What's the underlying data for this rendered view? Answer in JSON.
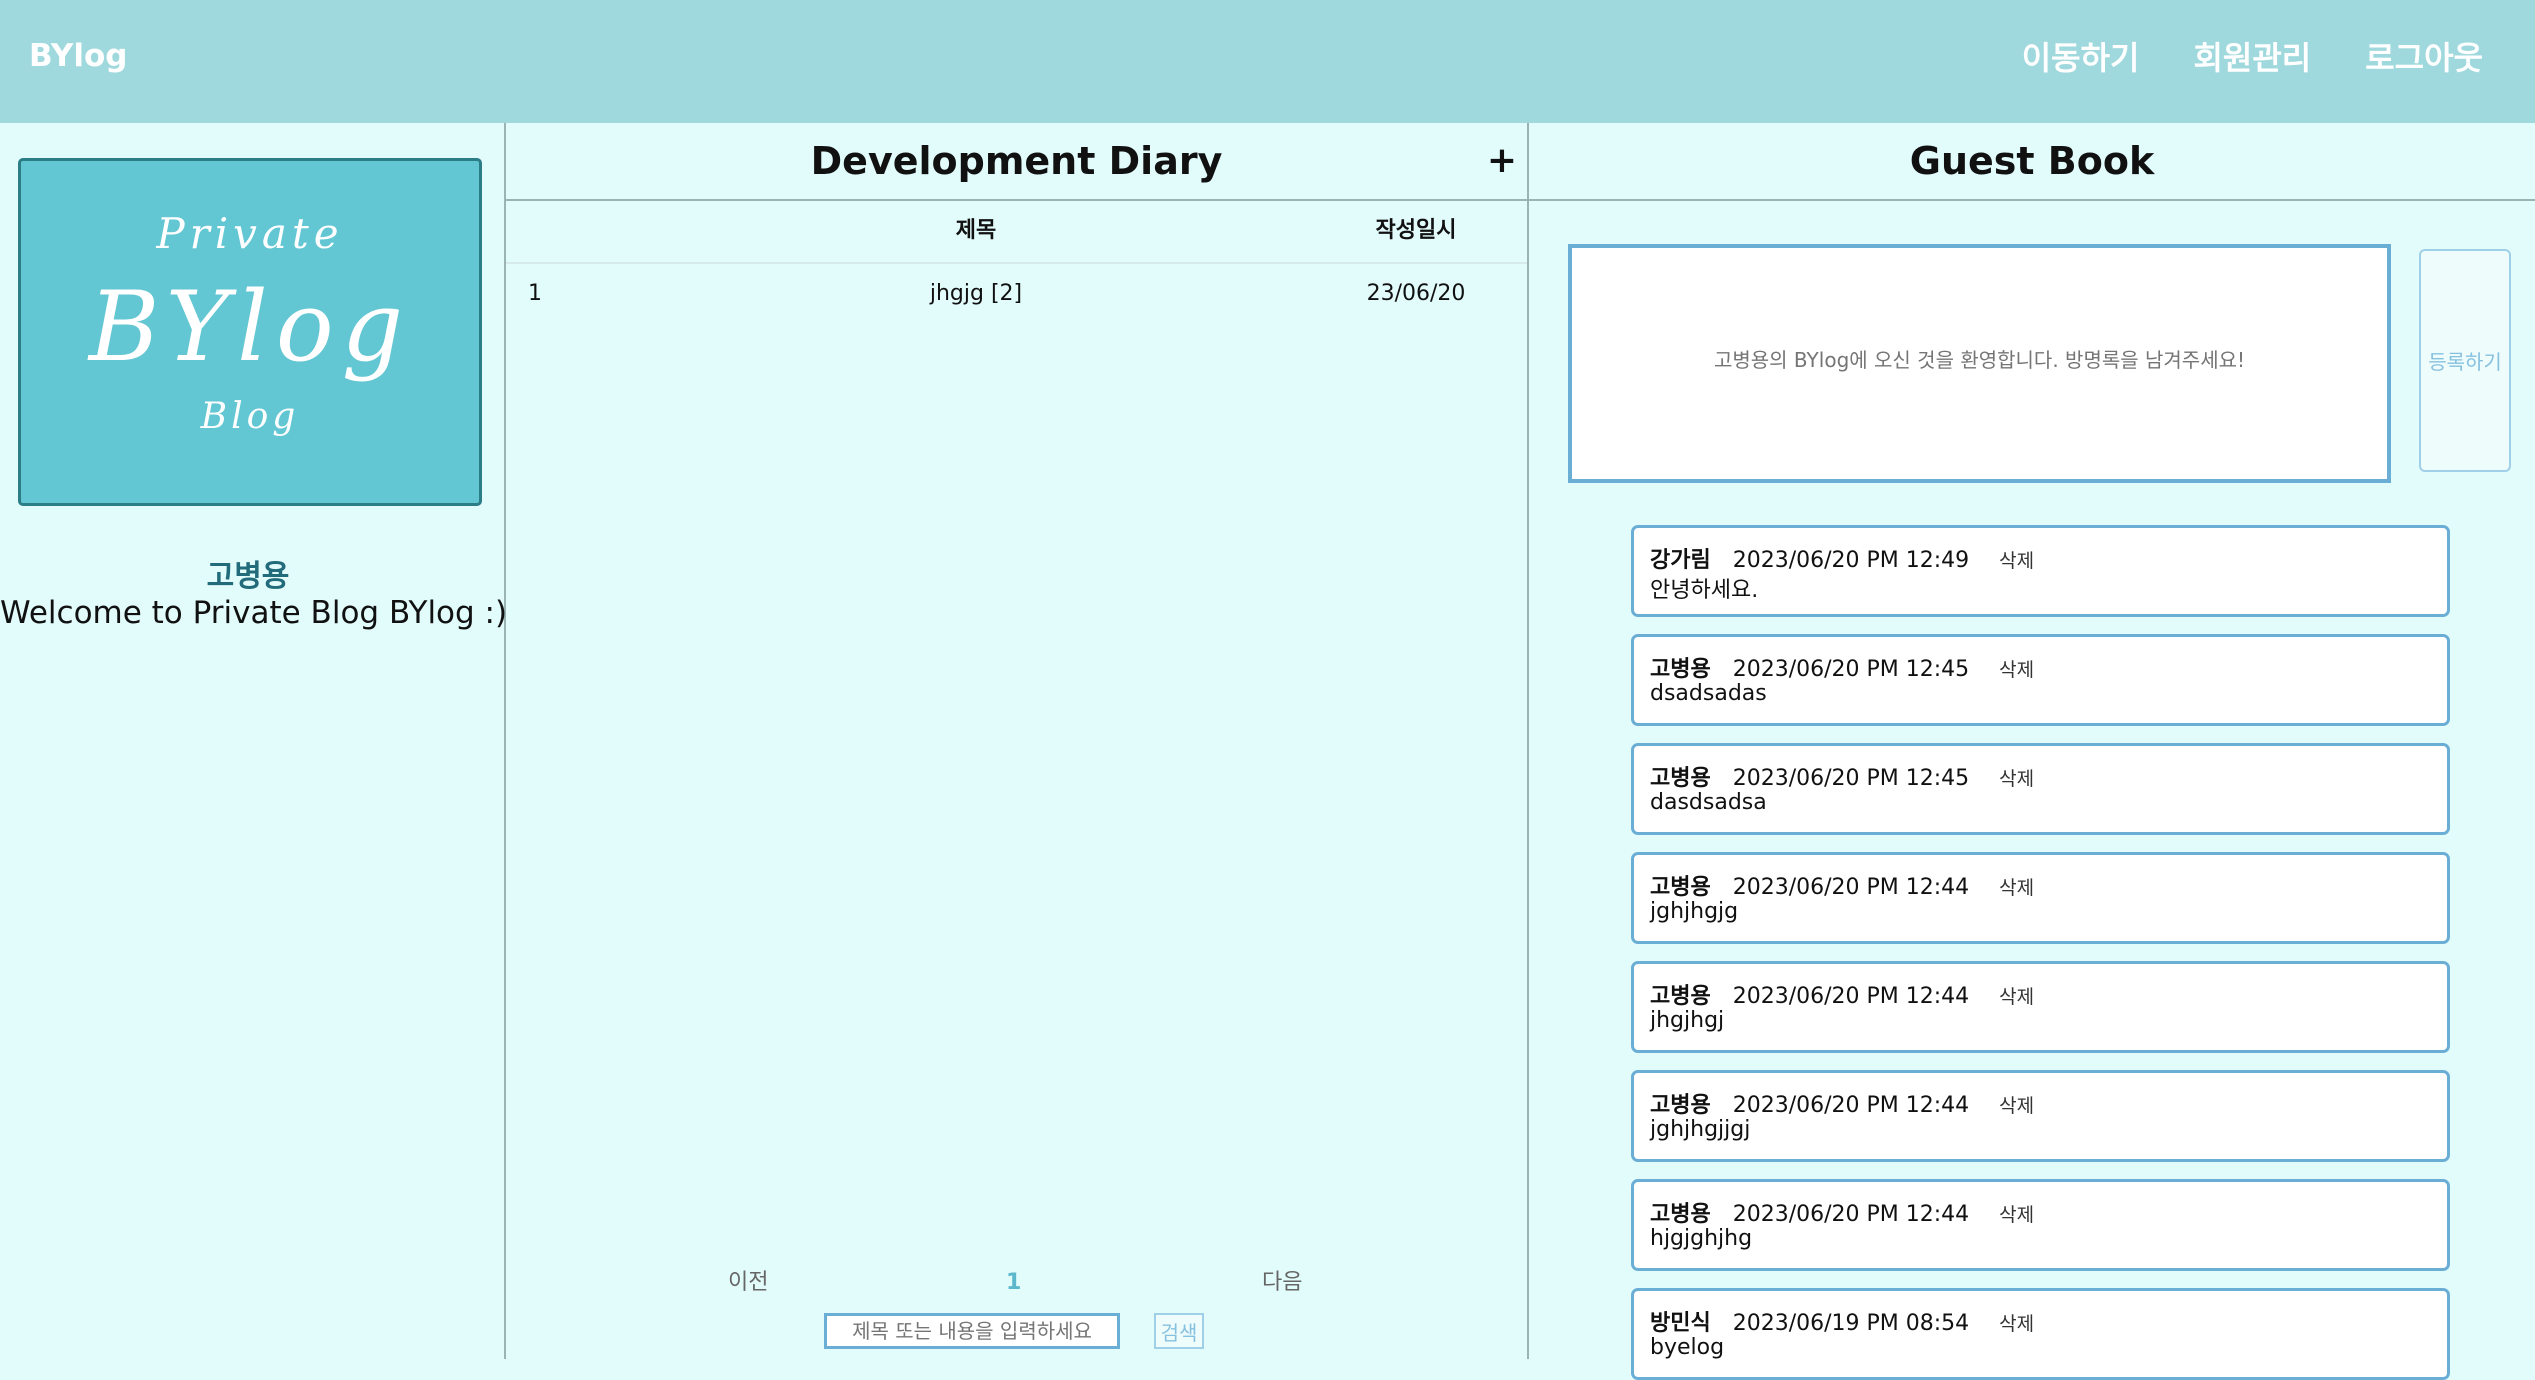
{
  "navbar": {
    "brand": "BYlog",
    "links": [
      "이동하기",
      "회원관리",
      "로그아웃"
    ]
  },
  "profile": {
    "logo_private": "Private",
    "logo_bylog": "BYlog",
    "logo_blog": "Blog",
    "name": "고병용",
    "welcome": "Welcome to Private Blog BYlog :)"
  },
  "diary": {
    "title": "Development Diary",
    "add_label": "+",
    "headers": {
      "title": "제목",
      "date": "작성일시"
    },
    "rows": [
      {
        "num": "1",
        "title": "jhgjg [2]",
        "date": "23/06/20"
      }
    ],
    "pager": {
      "prev": "이전",
      "current": "1",
      "next": "다음"
    },
    "search": {
      "placeholder": "제목 또는 내용을 입력하세요",
      "button": "검색"
    }
  },
  "guestbook": {
    "title": "Guest Book",
    "input_placeholder": "고병용의 BYlog에 오신 것을 환영합니다. 방명록을 남겨주세요!",
    "submit_label": "등록하기",
    "delete_label": "삭제",
    "entries": [
      {
        "author": "강가림",
        "time": "2023/06/20 PM 12:49",
        "body": "안녕하세요."
      },
      {
        "author": "고병용",
        "time": "2023/06/20 PM 12:45",
        "body": "dsadsadas"
      },
      {
        "author": "고병용",
        "time": "2023/06/20 PM 12:45",
        "body": "dasdsadsa"
      },
      {
        "author": "고병용",
        "time": "2023/06/20 PM 12:44",
        "body": "jghjhgjg"
      },
      {
        "author": "고병용",
        "time": "2023/06/20 PM 12:44",
        "body": "jhgjhgj"
      },
      {
        "author": "고병용",
        "time": "2023/06/20 PM 12:44",
        "body": "jghjhgjjgj"
      },
      {
        "author": "고병용",
        "time": "2023/06/20 PM 12:44",
        "body": "hjgjghjhg"
      },
      {
        "author": "방민식",
        "time": "2023/06/19 PM 08:54",
        "body": "byelog"
      }
    ]
  },
  "colors": {
    "navbar_bg": "#a0d9dd",
    "page_bg": "#e2fbfb",
    "logo_card_bg": "#62c6d3",
    "accent_border": "#6aaed6",
    "profile_name": "#226b7a"
  }
}
